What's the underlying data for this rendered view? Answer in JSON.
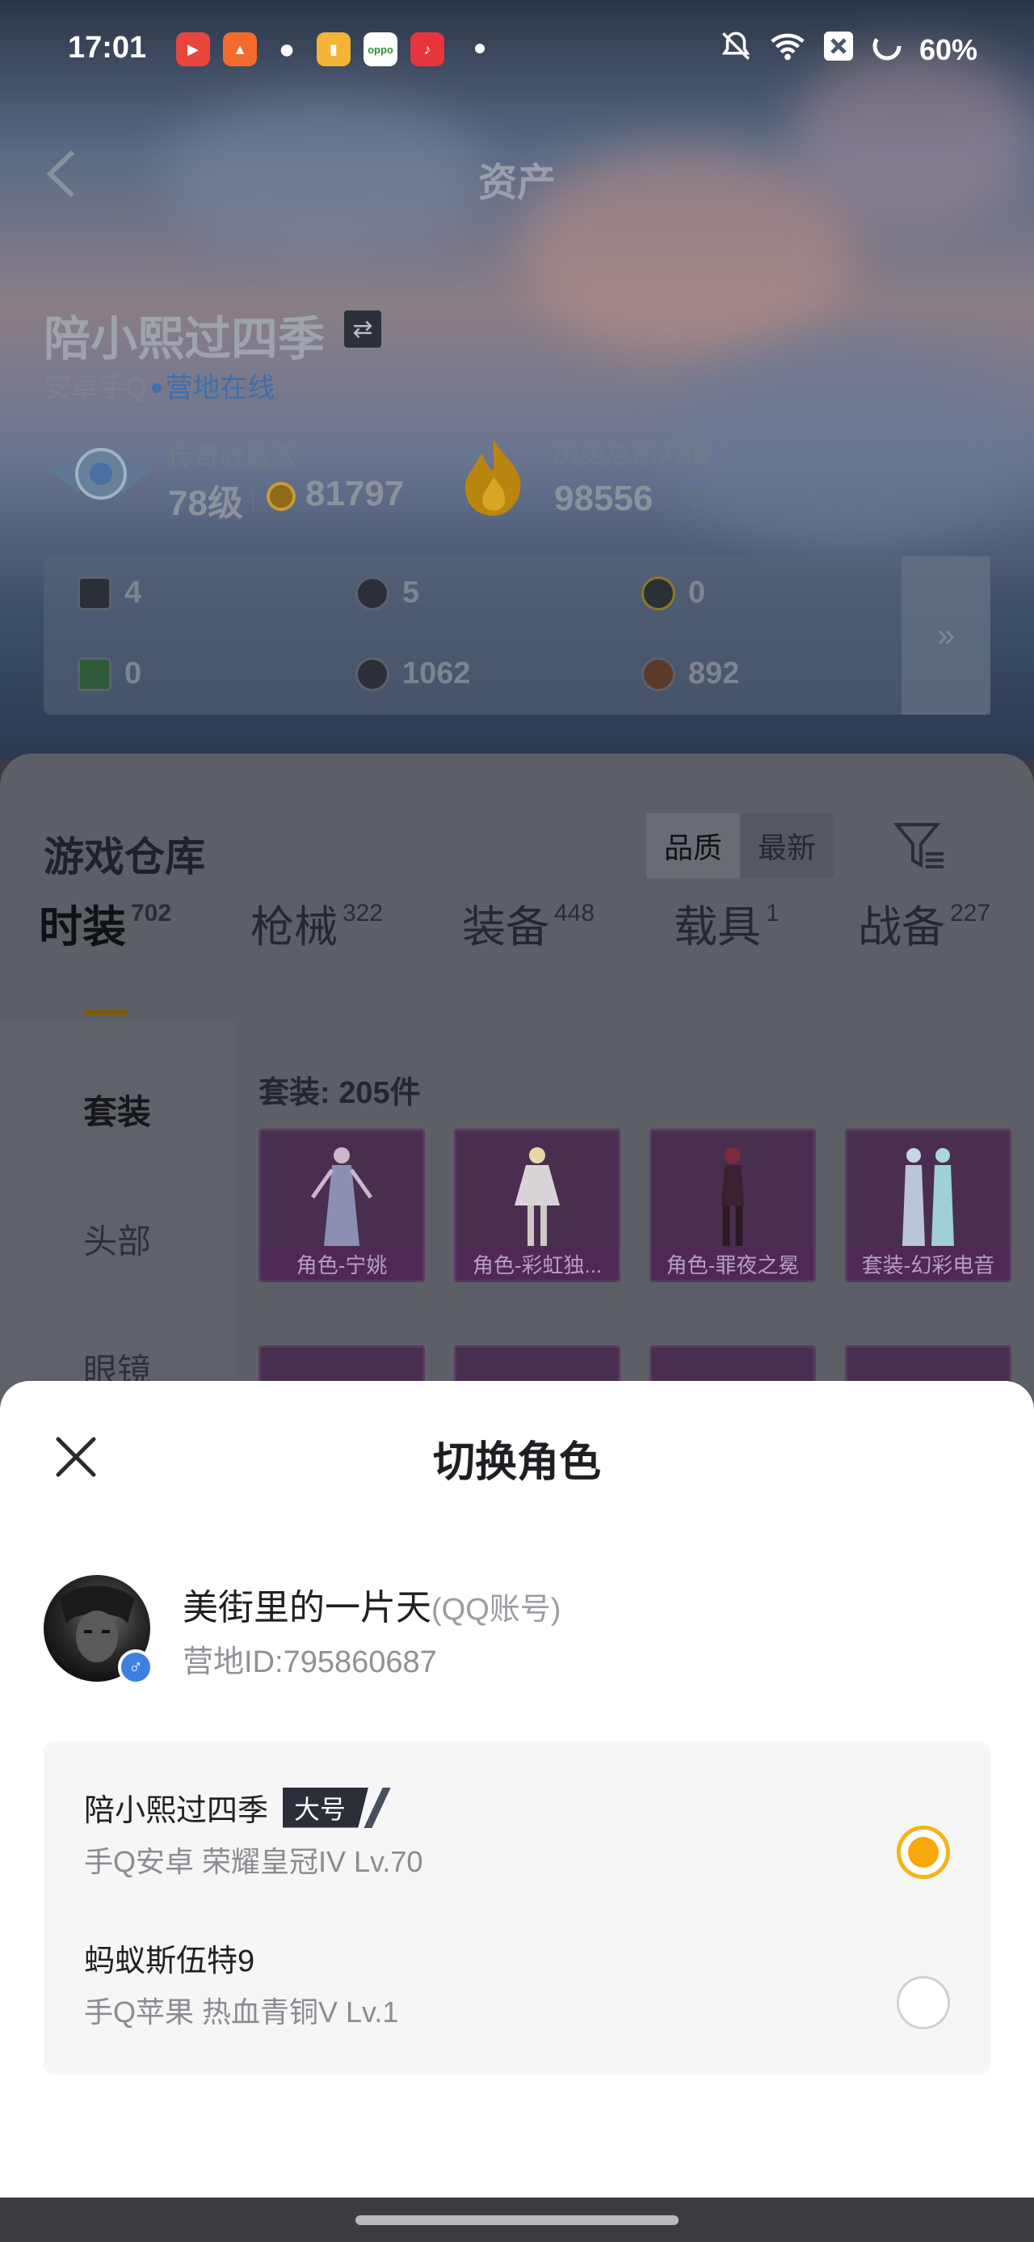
{
  "status_bar": {
    "time": "17:01",
    "battery": "60%",
    "apps": [
      {
        "name": "video-app-icon",
        "color": "#e8453c",
        "glyph": "▶"
      },
      {
        "name": "photo-app-icon",
        "color": "#f26b2d",
        "glyph": "▲"
      },
      {
        "name": "wechat-icon",
        "color": "#ffffff",
        "glyph": "●"
      },
      {
        "name": "notes-app-icon",
        "color": "#f5b437",
        "glyph": "▮"
      },
      {
        "name": "oppo-app-icon",
        "color": "#ffffff",
        "glyph": "oppo"
      },
      {
        "name": "music-app-icon",
        "color": "#e8343c",
        "glyph": "♪"
      }
    ]
  },
  "header": {
    "title": "资产",
    "player_name": "陪小熙过四季",
    "platform": "安卓手Q",
    "online_status": "营地在线"
  },
  "rank": {
    "title": "传奇收藏家",
    "level": "78级",
    "coins": "81797"
  },
  "heat": {
    "title": "历史总热力值",
    "value": "98556",
    "help": "?"
  },
  "stats": [
    "4",
    "5",
    "0",
    "0",
    "1062",
    "892"
  ],
  "warehouse": {
    "title": "游戏仓库",
    "sort_options": [
      "品质",
      "最新"
    ],
    "tabs": [
      {
        "label": "时装",
        "count": "702"
      },
      {
        "label": "枪械",
        "count": "322"
      },
      {
        "label": "装备",
        "count": "448"
      },
      {
        "label": "载具",
        "count": "1"
      },
      {
        "label": "战备",
        "count": "227"
      }
    ],
    "side_items": [
      "套装",
      "头部",
      "眼镜"
    ],
    "set_count": "套装: 205件",
    "items": [
      "角色-宁姚",
      "角色-彩虹独...",
      "角色-罪夜之冕",
      "套装-幻彩电音"
    ]
  },
  "sheet": {
    "title": "切换角色",
    "account_name": "美街里的一片天",
    "account_type": "(QQ账号)",
    "camp_id": "营地ID:795860687",
    "gender": "♂",
    "roles": [
      {
        "name": "陪小熙过四季",
        "tag": "大号",
        "info": "手Q安卓  荣耀皇冠IV  Lv.70",
        "selected": true
      },
      {
        "name": "蚂蚁斯伍特9",
        "tag": "",
        "info": "手Q苹果  热血青铜V  Lv.1",
        "selected": false
      }
    ]
  },
  "colors": {
    "accent": "#f7a80a",
    "link": "#3d6fae"
  }
}
